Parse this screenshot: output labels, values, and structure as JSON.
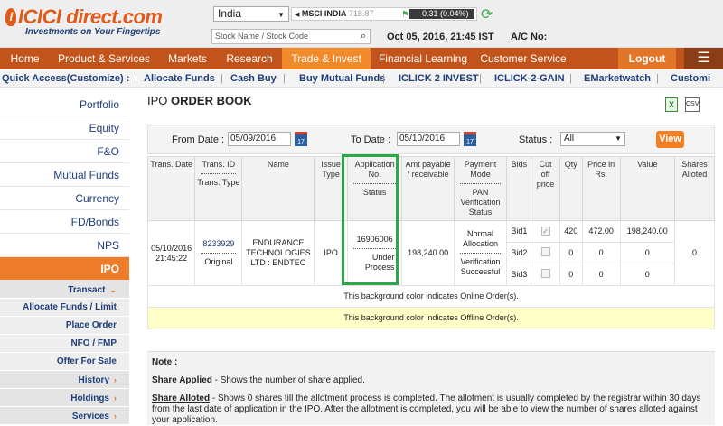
{
  "header": {
    "logo_text": "ICICI direct.com",
    "logo_tagline": "Investments on Your Fingertips",
    "market": "India",
    "ticker_name": "MSCI INDIA",
    "ticker_value": "718.87",
    "ticker_change": "0.31 (0.04%)",
    "search_placeholder": "Stock Name / Stock Code",
    "datetime": "Oct 05, 2016, 21:45 IST",
    "acno_label": "A/C No:"
  },
  "nav": {
    "items": [
      "Home",
      "Product & Services",
      "Markets",
      "Research",
      "Trade & Invest",
      "Financial Learning",
      "Customer Service"
    ],
    "logout": "Logout"
  },
  "quick_access": {
    "label": "Quick Access(Customize) :",
    "items": [
      "Allocate Funds",
      "Cash Buy",
      "Buy Mutual Funds",
      "ICLICK 2 INVEST",
      "ICLICK-2-GAIN",
      "EMarketwatch",
      "Customi"
    ]
  },
  "sidebar": {
    "items": [
      "Portfolio",
      "Equity",
      "F&O",
      "Mutual Funds",
      "Currency",
      "FD/Bonds",
      "NPS",
      "IPO"
    ],
    "sub": [
      "Transact",
      "Allocate Funds / Limit",
      "Place Order",
      "NFO / FMP",
      "Offer For Sale",
      "History",
      "Holdings",
      "Services"
    ]
  },
  "page": {
    "title_prefix": "IPO",
    "title_main": "ORDER BOOK"
  },
  "filter": {
    "from_label": "From Date :",
    "from_value": "05/09/2016",
    "to_label": "To Date :",
    "to_value": "05/10/2016",
    "status_label": "Status :",
    "status_value": "All",
    "view_label": "View"
  },
  "table": {
    "headers": {
      "trans_date": "Trans. Date",
      "trans_id": "Trans. ID",
      "trans_type": "Trans. Type",
      "name": "Name",
      "issue_type": "Issue Type",
      "app_no": "Application No.",
      "status": "Status",
      "amt": "Amt payable / receivable",
      "pay_mode": "Payment Mode",
      "pan": "PAN Verification Status",
      "bids": "Bids",
      "cutoff": "Cut off price",
      "qty": "Qty",
      "price": "Price in Rs.",
      "value": "Value",
      "alloted": "Shares Alloted"
    },
    "row": {
      "date": "05/10/2016 21:45:22",
      "trans_id": "8233929",
      "trans_type": "Original",
      "name": "ENDURANCE TECHNOLOGIES LTD : ENDTEC",
      "issue_type": "IPO",
      "app_no": "16906006",
      "status": "Under Process",
      "amt": "198,240.00",
      "pay_mode": "Normal Allocation",
      "pan": "Verification Successful",
      "alloted": "0",
      "bids": [
        {
          "bid": "Bid1",
          "qty": "420",
          "price": "472.00",
          "value": "198,240.00"
        },
        {
          "bid": "Bid2",
          "qty": "0",
          "price": "0",
          "value": "0"
        },
        {
          "bid": "Bid3",
          "qty": "0",
          "price": "0",
          "value": "0"
        }
      ]
    },
    "online_note": "This background color indicates Online Order(s).",
    "offline_note": "This background color indicates Offline Order(s)."
  },
  "notes": {
    "heading": "Note :",
    "share_applied_title": "Share Applied",
    "share_applied_text": " - Shows the number of share applied.",
    "share_alloted_title": "Share Alloted",
    "share_alloted_text": " - Shows 0 shares till the allotment process is completed. The allotment is usually completed by the registrar within 30 days from the last date of application in the IPO. After the allotment is completed, you will be able to view the number of shares alloted against your application."
  }
}
